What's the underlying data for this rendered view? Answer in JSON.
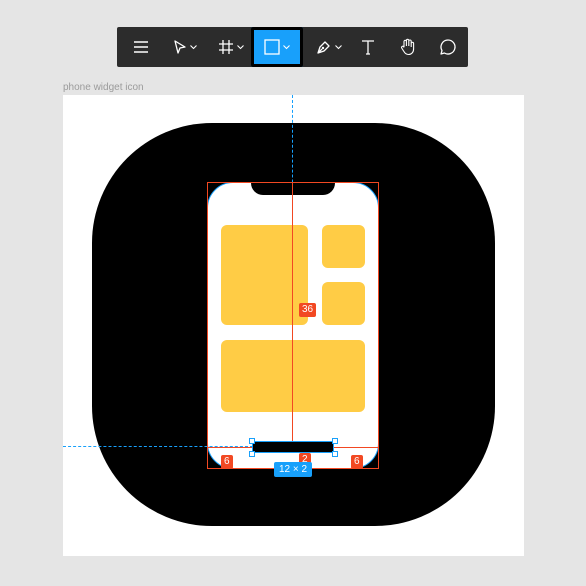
{
  "toolbar": {
    "tools": [
      {
        "name": "menu-icon",
        "dropdown": false
      },
      {
        "name": "move-tool-icon",
        "dropdown": true
      },
      {
        "name": "frame-tool-icon",
        "dropdown": true
      },
      {
        "name": "rectangle-tool-icon",
        "dropdown": true,
        "active": true
      },
      {
        "name": "pen-tool-icon",
        "dropdown": true
      },
      {
        "name": "text-tool-icon",
        "dropdown": false
      },
      {
        "name": "hand-tool-icon",
        "dropdown": false
      },
      {
        "name": "comment-tool-icon",
        "dropdown": false
      }
    ]
  },
  "canvas": {
    "frame_label": "phone widget icon",
    "measurements": {
      "center_distance": "36",
      "left_gap": "6",
      "bottom_gap": "2",
      "right_gap": "6"
    },
    "selection_size": "12 × 2"
  },
  "colors": {
    "accent": "#18a0fb",
    "measure": "#f24822",
    "widget_yellow": "#ffcc45",
    "icon_background": "#000000"
  }
}
